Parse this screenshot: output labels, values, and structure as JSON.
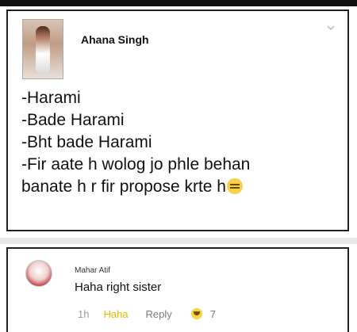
{
  "post": {
    "author": "Ahana Singh",
    "lines": [
      "-Harami",
      "-Bade Harami",
      "-Bht bade Harami",
      "-Fir aate h wolog jo phle behan",
      "banate h r fir propose krte h"
    ],
    "emoji": "expressionless-face-emoji"
  },
  "comment": {
    "author": "Mahar Atif",
    "text": "Haha right sister",
    "time": "1h",
    "haha_label": "Haha",
    "reply_label": "Reply",
    "reaction_count": "7"
  },
  "icons": {
    "chevron": "chevron-down-icon",
    "reaction": "haha-reaction-icon"
  },
  "colors": {
    "haha": "#e3b900",
    "text": "#111111"
  }
}
